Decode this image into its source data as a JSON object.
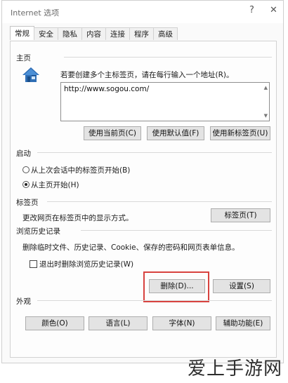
{
  "window": {
    "title": "Internet 选项",
    "help_glyph": "?",
    "close_glyph": "✕"
  },
  "tabs": [
    "常规",
    "安全",
    "隐私",
    "内容",
    "连接",
    "程序",
    "高级"
  ],
  "homepage": {
    "label": "主页",
    "instruction": "若要创建多个主标签页，请在每行输入一个地址(R)。",
    "url": "http://www.sogou.com/",
    "use_current": "使用当前页(C)",
    "use_default": "使用默认值(F)",
    "use_new_tab": "使用新标签页(U)"
  },
  "startup": {
    "label": "启动",
    "option_last_session": "从上次会话中的标签页开始(B)",
    "option_home": "从主页开始(H)",
    "selected": "option_home"
  },
  "tabs_section": {
    "label": "标签页",
    "description": "更改网页在标签页中的显示方式。",
    "button": "标签页(T)"
  },
  "history": {
    "label": "浏览历史记录",
    "description": "删除临时文件、历史记录、Cookie、保存的密码和网页表单信息。",
    "delete_on_exit": "退出时删除浏览历史记录(W)",
    "delete_on_exit_checked": false,
    "delete_button": "删除(D)...",
    "settings_button": "设置(S)"
  },
  "appearance": {
    "label": "外观",
    "colors": "颜色(O)",
    "languages": "语言(L)",
    "fonts": "字体(N)",
    "accessibility": "辅助功能(E)"
  },
  "watermark": "爱上手游网",
  "colors": {
    "highlight": "#d8423f",
    "button_face": "#e3e3e3"
  }
}
